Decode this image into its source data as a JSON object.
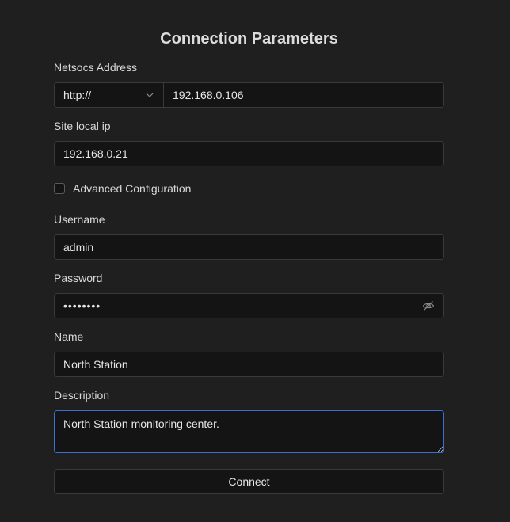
{
  "form": {
    "title": "Connection Parameters",
    "netsocs_address": {
      "label": "Netsocs Address",
      "protocol": "http://",
      "value": "192.168.0.106"
    },
    "site_local_ip": {
      "label": "Site local ip",
      "value": "192.168.0.21"
    },
    "advanced_configuration": {
      "label": "Advanced Configuration",
      "checked": false
    },
    "username": {
      "label": "Username",
      "value": "admin"
    },
    "password": {
      "label": "Password",
      "value": "••••••••"
    },
    "name": {
      "label": "Name",
      "value": "North Station"
    },
    "description": {
      "label": "Description",
      "value": "North Station monitoring center."
    },
    "connect_label": "Connect"
  },
  "icons": {
    "protocol_dropdown": "chevron-down-icon",
    "password_toggle": "eye-off-icon"
  },
  "colors": {
    "background": "#1f1f1f",
    "field_background": "#141414",
    "border": "#3a3a3a",
    "focus_border": "#3a6fd6",
    "text": "#e6e6e6"
  }
}
